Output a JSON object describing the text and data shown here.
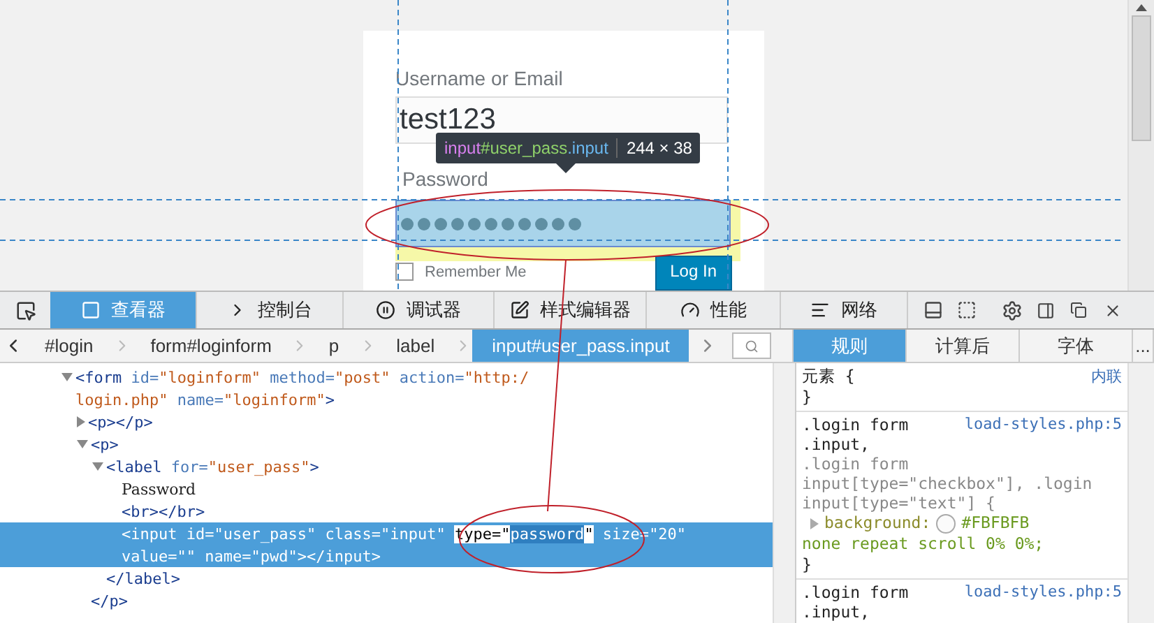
{
  "page": {
    "login": {
      "username_label": "Username or Email",
      "username_value": "test123",
      "password_label": "Password",
      "remember_label": "Remember Me",
      "remember_checked": false,
      "login_button": "Log In"
    },
    "highlighter": {
      "tag": "input",
      "id": "#user_pass",
      "cls": ".input",
      "size": "244 × 38"
    }
  },
  "toolbar": {
    "tabs": [
      {
        "label": "查看器",
        "selected": true
      },
      {
        "label": "控制台",
        "selected": false
      },
      {
        "label": "调试器",
        "selected": false
      },
      {
        "label": "样式编辑器",
        "selected": false
      },
      {
        "label": "性能",
        "selected": false
      },
      {
        "label": "网络",
        "selected": false
      }
    ]
  },
  "breadcrumbs": [
    {
      "label": "#login",
      "selected": false
    },
    {
      "label": "form#loginform",
      "selected": false
    },
    {
      "label": "p",
      "selected": false
    },
    {
      "label": "label",
      "selected": false
    },
    {
      "label": "input#user_pass.input",
      "selected": true
    }
  ],
  "markup": [
    {
      "expanded": true,
      "selected": false,
      "lines": [
        [
          {
            "kind": "tag",
            "text": "<form"
          },
          {
            "kind": "attr",
            "text": " id="
          },
          {
            "kind": "value",
            "text": "\"loginform\""
          },
          {
            "kind": "attr",
            "text": " method="
          },
          {
            "kind": "value",
            "text": "\"post\""
          },
          {
            "kind": "attr",
            "text": " action="
          },
          {
            "kind": "value",
            "text": "\"http:/"
          }
        ],
        [
          {
            "kind": "value",
            "text": "login.php\""
          },
          {
            "kind": "attr",
            "text": " name="
          },
          {
            "kind": "value",
            "text": "\"loginform\""
          },
          {
            "kind": "tag",
            "text": ">"
          }
        ]
      ],
      "children": [
        {
          "expanded": false,
          "selected": false,
          "lines": [
            [
              {
                "kind": "tag",
                "text": "<p></p>"
              }
            ]
          ]
        },
        {
          "expanded": true,
          "selected": false,
          "lines": [
            [
              {
                "kind": "tag",
                "text": "<p>"
              }
            ]
          ],
          "closing": "</p>",
          "children": [
            {
              "expanded": true,
              "selected": false,
              "lines": [
                [
                  {
                    "kind": "tag",
                    "text": "<label"
                  },
                  {
                    "kind": "attr",
                    "text": " for="
                  },
                  {
                    "kind": "value",
                    "text": "\"user_pass\""
                  },
                  {
                    "kind": "tag",
                    "text": ">"
                  }
                ]
              ],
              "closing": "</label>",
              "children": [
                {
                  "selected": false,
                  "lines": [
                    [
                      {
                        "kind": "text",
                        "text": "Password"
                      }
                    ]
                  ]
                },
                {
                  "selected": false,
                  "lines": [
                    [
                      {
                        "kind": "tag",
                        "text": "<br></br>"
                      }
                    ]
                  ]
                },
                {
                  "selected": true,
                  "lines": [
                    [
                      {
                        "kind": "tag",
                        "text": "<input"
                      },
                      {
                        "kind": "attr",
                        "text": " id="
                      },
                      {
                        "kind": "value",
                        "text": "\"user_pass\""
                      },
                      {
                        "kind": "attr",
                        "text": " class="
                      },
                      {
                        "kind": "value",
                        "text": "\"input\" "
                      },
                      {
                        "kind": "match",
                        "text": "type=\""
                      },
                      {
                        "kind": "current",
                        "text": "password"
                      },
                      {
                        "kind": "match",
                        "text": "\""
                      },
                      {
                        "kind": "attr",
                        "text": " size="
                      },
                      {
                        "kind": "value",
                        "text": "\"20\""
                      }
                    ],
                    [
                      {
                        "kind": "attr",
                        "text": "value="
                      },
                      {
                        "kind": "value",
                        "text": "\"\""
                      },
                      {
                        "kind": "attr",
                        "text": " name="
                      },
                      {
                        "kind": "value",
                        "text": "\"pwd\""
                      },
                      {
                        "kind": "tag",
                        "text": "></input>"
                      }
                    ]
                  ]
                }
              ]
            }
          ]
        }
      ]
    }
  ],
  "side_tabs": [
    {
      "label": "规则",
      "selected": true
    },
    {
      "label": "计算后",
      "selected": false
    },
    {
      "label": "字体",
      "selected": false
    },
    {
      "label": "...",
      "selected": false
    }
  ],
  "rules": [
    {
      "selectors": [
        {
          "text": "元素 {",
          "matched": true
        }
      ],
      "source": "内联",
      "close": "}"
    },
    {
      "selectors": [
        {
          "text": ".login form",
          "matched": true
        },
        {
          "text": ".input,",
          "matched": true
        },
        {
          "text": ".login form",
          "matched": false
        },
        {
          "text": "input[type=\"checkbox\"], .login",
          "matched": false
        },
        {
          "text": "input[type=\"text\"] {",
          "matched": false
        }
      ],
      "source": "load-styles.php:5",
      "declarations": [
        {
          "property": "background:",
          "color": "#fbfbfb",
          "value": "#FBFBFB",
          "rest": "none repeat scroll 0% 0%;"
        }
      ],
      "close": "}"
    },
    {
      "selectors": [
        {
          "text": ".login form",
          "matched": true
        },
        {
          "text": ".input,",
          "matched": true
        }
      ],
      "source": "load-styles.php:5"
    }
  ]
}
